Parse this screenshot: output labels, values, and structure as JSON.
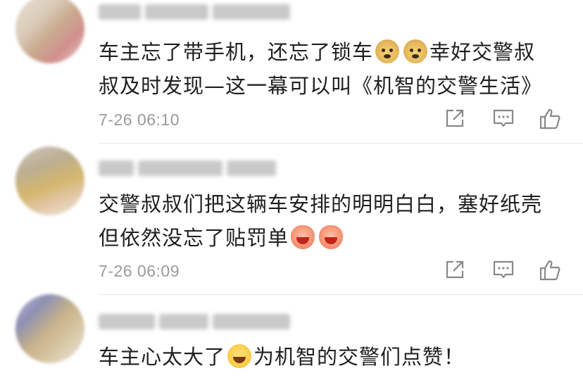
{
  "comments": [
    {
      "text_line1": "车主忘了带手机，还忘了锁车",
      "emoji_a": "doge-emoji",
      "emoji_b": "doge-emoji",
      "text_line1_tail": "幸好交警叔",
      "text_line2": "叔及时发现—这一幕可以叫《机智的交警生活》",
      "time": "7-26 06:10"
    },
    {
      "text_line1": "交警叔叔们把这辆车安排的明明白白，塞好纸壳",
      "text_line2": "但依然没忘了贴罚单",
      "emoji_a": "haha-emoji",
      "emoji_b": "haha-emoji",
      "time": "7-26 06:09"
    },
    {
      "text_line1": "车主心太大了",
      "emoji_a": "laugh-cry-emoji",
      "text_line1_tail": "为机智的交警们点赞！"
    }
  ],
  "icons": {
    "share": "share-icon",
    "reply": "comment-icon",
    "like": "thumbs-up-icon"
  },
  "colors": {
    "text": "#1f1f1f",
    "meta": "#9a9a9a",
    "divider": "#e6e6e6",
    "icon": "#888888"
  }
}
